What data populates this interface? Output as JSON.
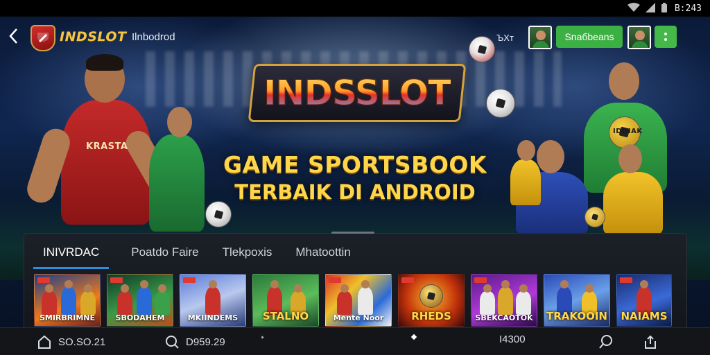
{
  "status_bar": {
    "time": "B:243",
    "icons": [
      "wifi-icon",
      "signal-icon",
      "battery-icon"
    ]
  },
  "top_bar": {
    "brand": "INDSLOT",
    "subtitle": "Ilnbodrod",
    "small_text": "ЪXт",
    "login_label": "Snaбbeans"
  },
  "hero": {
    "logo_title": "INDSSLOT",
    "tagline_line1": "GAME SPORTSBOOK",
    "tagline_line2": "TERBAIK DI ANDROID",
    "jersey_text": "KRASTA",
    "jersey_text_right": "IDINAK"
  },
  "tabs": [
    {
      "label": "INIVRDAC",
      "active": true
    },
    {
      "label": "Poatdo Faire",
      "active": false
    },
    {
      "label": "Tlekpoxis",
      "active": false
    },
    {
      "label": "Mhatoottin",
      "active": false
    }
  ],
  "games": [
    {
      "label": "SMIRBRIMNE",
      "style": "small"
    },
    {
      "label": "SBODAHEM",
      "style": "small"
    },
    {
      "label": "MKIINDEMS",
      "style": "small"
    },
    {
      "label": "STALNO",
      "style": "big"
    },
    {
      "label": "Mente Noor",
      "style": "small"
    },
    {
      "label": "RHEDS",
      "style": "big"
    },
    {
      "label": "SBEKCAOTOK",
      "style": "small"
    },
    {
      "label": "TRAKOOIN",
      "style": "big"
    },
    {
      "label": "NAIAMS",
      "style": "big"
    }
  ],
  "bottom_nav": {
    "home_label": "SO.SO.21",
    "search_label": "D959.29",
    "center_label": "I4300",
    "icons": [
      "home-icon",
      "search-icon",
      "zoom-icon",
      "share-icon"
    ]
  },
  "colors": {
    "accent_green": "#3cb043",
    "tab_underline": "#2b8fe0",
    "headline_gold": "#ffd54a"
  }
}
